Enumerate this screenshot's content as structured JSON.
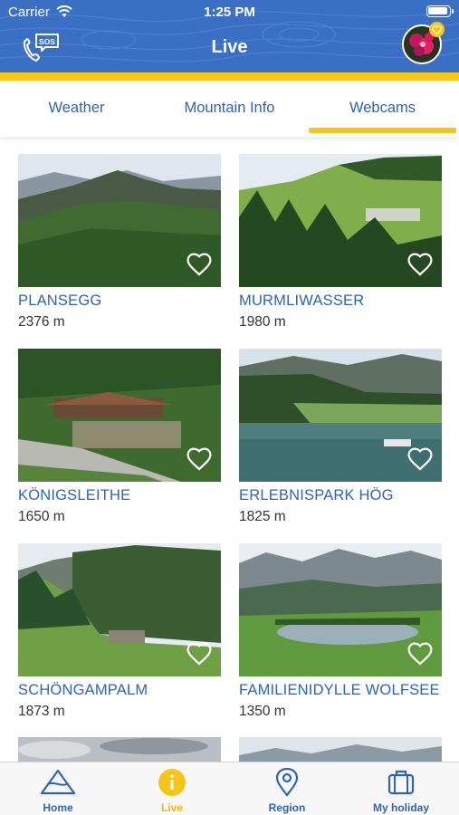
{
  "status_bar": {
    "carrier": "Carrier",
    "time": "1:25 PM"
  },
  "header": {
    "title": "Live",
    "sos_label": "SOS"
  },
  "tabs": [
    {
      "label": "Weather",
      "active": false
    },
    {
      "label": "Mountain Info",
      "active": false
    },
    {
      "label": "Webcams",
      "active": true
    }
  ],
  "webcams": [
    {
      "name": "PLANSEGG",
      "altitude": "2376 m"
    },
    {
      "name": "MURMLIWASSER",
      "altitude": "1980 m"
    },
    {
      "name": "KÖNIGSLEITHE",
      "altitude": "1650 m"
    },
    {
      "name": "ERLEBNISPARK HÖG",
      "altitude": "1825 m"
    },
    {
      "name": "SCHÖNGAMPALM",
      "altitude": "1873 m"
    },
    {
      "name": "FAMILIENIDYLLE WOLFSEE",
      "altitude": "1350 m"
    }
  ],
  "bottom_nav": [
    {
      "label": "Home",
      "icon": "mountain-icon",
      "active": false
    },
    {
      "label": "Live",
      "icon": "info-icon",
      "active": true
    },
    {
      "label": "Region",
      "icon": "location-pin-icon",
      "active": false
    },
    {
      "label": "My holiday",
      "icon": "suitcase-icon",
      "active": false
    }
  ],
  "colors": {
    "brand_blue": "#3a6fc4",
    "link_blue": "#2f64b0",
    "accent_yellow": "#f5c518"
  }
}
